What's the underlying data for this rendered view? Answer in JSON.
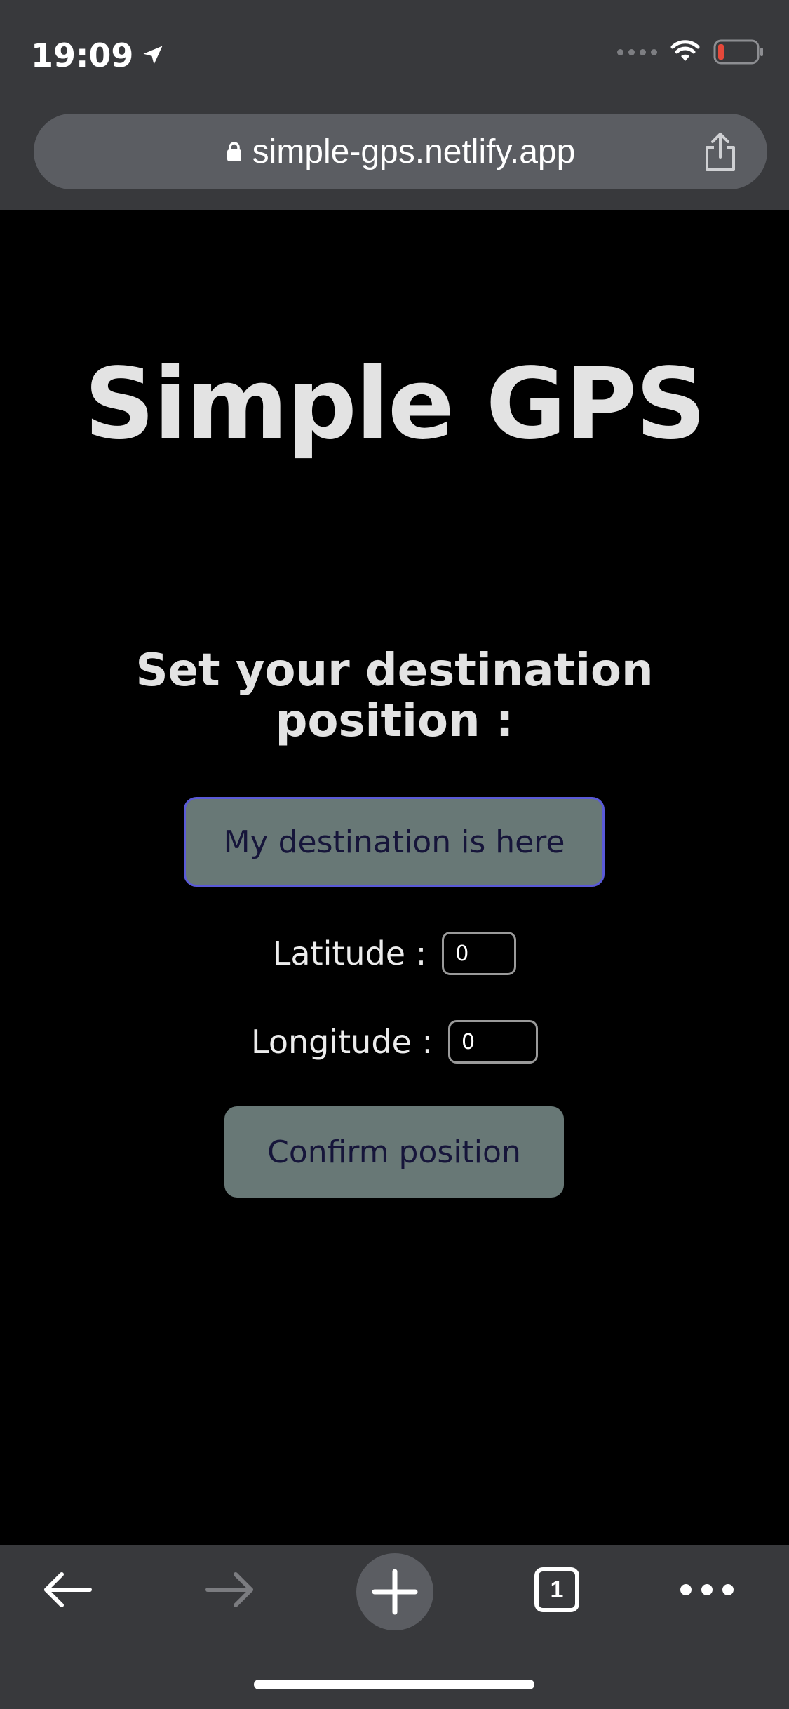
{
  "status_bar": {
    "time": "19:09"
  },
  "browser": {
    "url": "simple-gps.netlify.app",
    "tab_count": "1"
  },
  "page": {
    "title": "Simple GPS",
    "subtitle": "Set your destination position :",
    "destination_button_label": "My destination is here",
    "latitude_label": "Latitude :",
    "latitude_value": "0",
    "longitude_label": "Longitude :",
    "longitude_value": "0",
    "confirm_button_label": "Confirm position"
  },
  "colors": {
    "chrome_background": "#38393c",
    "url_bar": "#5b5d62",
    "page_background": "#000000",
    "button_background": "#687876",
    "button_text": "#16153a",
    "button_focus_border": "#5a5ad8",
    "battery_low": "#e5483a"
  },
  "icons": {
    "status_location": "location-arrow-icon",
    "lock": "lock-icon",
    "share": "share-icon",
    "back": "arrow-left-icon",
    "forward": "arrow-right-icon",
    "new_tab": "plus-icon",
    "more": "more-dots-icon"
  }
}
